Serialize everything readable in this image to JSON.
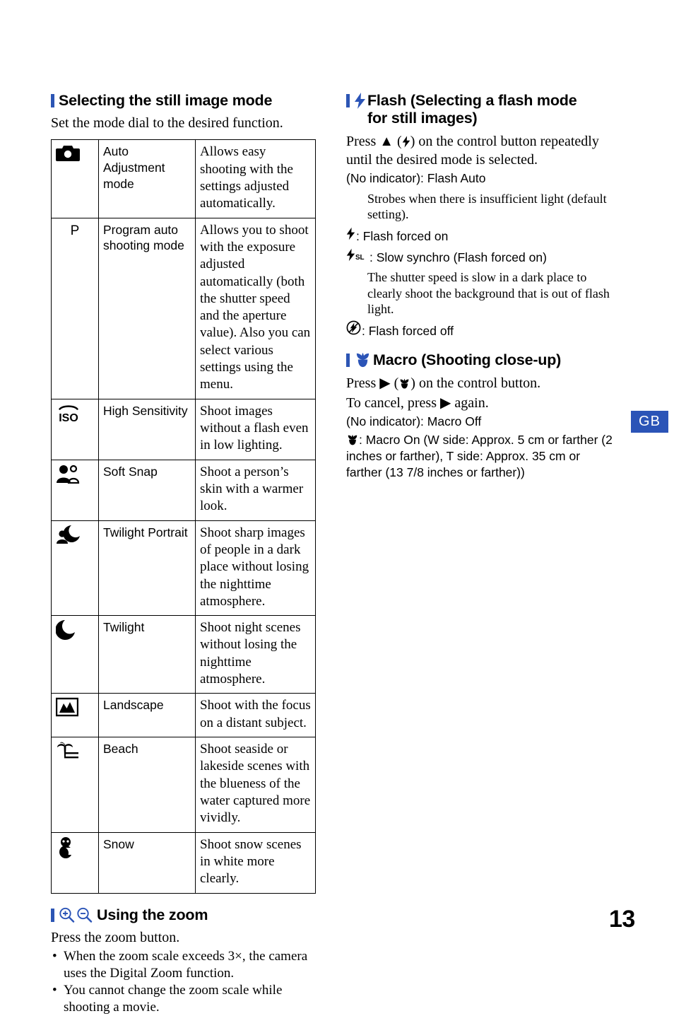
{
  "page": {
    "number": "13",
    "region_badge": "GB",
    "accent_color": "#2b54b7"
  },
  "left_column": {
    "section_still_image": {
      "heading": "Selecting the still image mode",
      "intro": "Set the mode dial to the desired function.",
      "table": {
        "rows": [
          {
            "icon": "camera-icon",
            "name": "Auto Adjustment mode",
            "description": "Allows easy shooting with the settings adjusted automatically."
          },
          {
            "icon": "letter-p",
            "icon_text": "P",
            "name": "Program auto shooting mode",
            "description": "Allows you to shoot with the exposure adjusted automatically (both the shutter speed and the aperture value). Also you can select various settings using the menu."
          },
          {
            "icon": "iso-icon",
            "icon_text": "ISO",
            "name": "High Sensitivity",
            "description": "Shoot images without a flash even in low lighting."
          },
          {
            "icon": "soft-snap-icon",
            "name": "Soft Snap",
            "description": "Shoot a person’s skin with a warmer look."
          },
          {
            "icon": "twilight-portrait-icon",
            "name": "Twilight Portrait",
            "description": "Shoot sharp images of people in a dark place without losing the nighttime atmosphere."
          },
          {
            "icon": "moon-icon",
            "name": "Twilight",
            "description": "Shoot night scenes without losing the nighttime atmosphere."
          },
          {
            "icon": "landscape-icon",
            "name": "Landscape",
            "description": "Shoot with the focus on a distant subject."
          },
          {
            "icon": "beach-icon",
            "name": "Beach",
            "description": "Shoot seaside or lakeside scenes with the blueness of the water captured more vividly."
          },
          {
            "icon": "snow-icon",
            "name": "Snow",
            "description": "Shoot snow scenes in white more clearly."
          }
        ]
      }
    },
    "section_zoom": {
      "heading": "Using the zoom",
      "icons": [
        "zoom-in-icon",
        "zoom-out-icon"
      ],
      "intro": "Press the zoom button.",
      "bullets": [
        "When the zoom scale exceeds 3×, the camera uses the Digital Zoom function.",
        "You cannot change the zoom scale while shooting a movie."
      ]
    }
  },
  "right_column": {
    "section_flash": {
      "heading_line1": "Flash (Selecting a flash mode",
      "heading_line2": "for still images)",
      "heading_icon": "flash-icon",
      "instruction": "on the control button repeatedly until the desired mode is selected.",
      "instruction_prefix": "Press",
      "instruction_triangle": "▲",
      "no_indicator_line": "(No indicator): Flash Auto",
      "no_indicator_detail": "Strobes when there is insufficient light (default setting).",
      "modes": [
        {
          "icon": "flash-icon",
          "label": ": Flash forced on"
        },
        {
          "icon": "flash-slow-sync-icon",
          "label": ": Slow synchro (Flash forced on)"
        }
      ],
      "slow_sync_detail": "The shutter speed is slow in a dark place to clearly shoot the background that is out of flash light.",
      "flash_off": {
        "icon": "flash-off-icon",
        "label": ": Flash forced off"
      }
    },
    "section_macro": {
      "heading": "Macro (Shooting close-up)",
      "heading_icon": "macro-flower-icon",
      "press_prefix": "Press",
      "press_triangle": "▶",
      "press_suffix": "on the control button.",
      "cancel_line_prefix": "To cancel, press",
      "cancel_triangle": "▶",
      "cancel_line_suffix": "again.",
      "no_indicator_line": "(No indicator): Macro Off",
      "macro_on_text": ": Macro On (W side: Approx. 5 cm or farther (2 inches or farther), T side: Approx. 35 cm or farther (13 7/8 inches or farther))",
      "macro_on_icon": "macro-flower-icon"
    }
  }
}
